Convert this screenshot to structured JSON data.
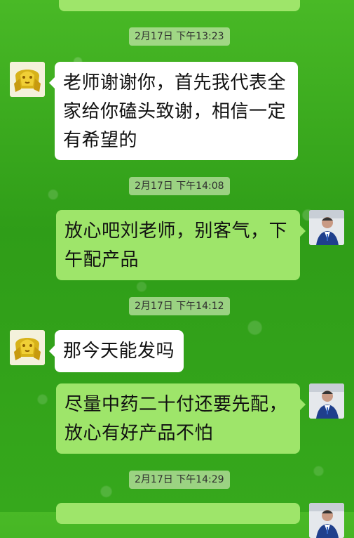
{
  "chat": {
    "timestamps": [
      "2月17日 下午13:23",
      "2月17日 下午14:08",
      "2月17日 下午14:12",
      "2月17日 下午14:29"
    ],
    "messages": [
      {
        "side": "left",
        "avatar_icon": "golden-statue-avatar-icon",
        "lines": [
          "老师谢谢你，首先我代表全",
          "家给你磕头致谢，相信一定",
          "有希望的"
        ]
      },
      {
        "side": "right",
        "avatar_icon": "man-photo-avatar-icon",
        "lines": [
          "放心吧刘老师，别客气，下",
          "午配产品"
        ]
      },
      {
        "side": "left",
        "avatar_icon": "golden-statue-avatar-icon",
        "lines": [
          "那今天能发吗"
        ]
      },
      {
        "side": "right",
        "avatar_icon": "man-photo-avatar-icon",
        "lines": [
          "尽量中药二十付还要先配，",
          "放心有好产品不怕"
        ]
      }
    ]
  },
  "colors": {
    "background_green": "#3aa91d",
    "received_bubble": "#ffffff",
    "sent_bubble": "#9ee56a"
  }
}
